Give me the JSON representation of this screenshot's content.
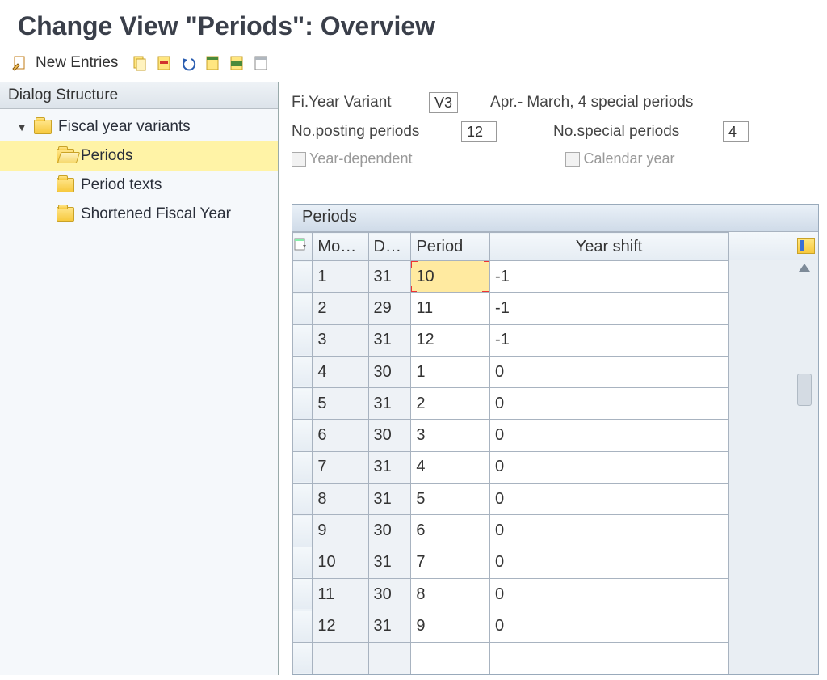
{
  "title": "Change View \"Periods\": Overview",
  "toolbar": {
    "new_entries_label": "New Entries"
  },
  "sidebar": {
    "title": "Dialog Structure",
    "root_label": "Fiscal year variants",
    "items": [
      {
        "label": "Periods",
        "selected": true
      },
      {
        "label": "Period texts",
        "selected": false
      },
      {
        "label": "Shortened Fiscal Year",
        "selected": false
      }
    ]
  },
  "info": {
    "variant_label": "Fi.Year Variant",
    "variant_value": "V3",
    "variant_desc": "Apr.- March, 4 special periods",
    "posting_label": "No.posting periods",
    "posting_value": "12",
    "special_label": "No.special periods",
    "special_value": "4",
    "year_dep_label": "Year-dependent",
    "cal_year_label": "Calendar year"
  },
  "table": {
    "title": "Periods",
    "columns": {
      "mo": "Mo…",
      "day": "D…",
      "period": "Period",
      "ys": "Year shift"
    },
    "rows": [
      {
        "mo": "1",
        "day": "31",
        "period": "10",
        "ys": "-1",
        "focus": true
      },
      {
        "mo": "2",
        "day": "29",
        "period": "11",
        "ys": "-1"
      },
      {
        "mo": "3",
        "day": "31",
        "period": "12",
        "ys": "-1"
      },
      {
        "mo": "4",
        "day": "30",
        "period": "1",
        "ys": "0"
      },
      {
        "mo": "5",
        "day": "31",
        "period": "2",
        "ys": "0"
      },
      {
        "mo": "6",
        "day": "30",
        "period": "3",
        "ys": "0"
      },
      {
        "mo": "7",
        "day": "31",
        "period": "4",
        "ys": "0"
      },
      {
        "mo": "8",
        "day": "31",
        "period": "5",
        "ys": "0"
      },
      {
        "mo": "9",
        "day": "30",
        "period": "6",
        "ys": "0"
      },
      {
        "mo": "10",
        "day": "31",
        "period": "7",
        "ys": "0"
      },
      {
        "mo": "11",
        "day": "30",
        "period": "8",
        "ys": "0"
      },
      {
        "mo": "12",
        "day": "31",
        "period": "9",
        "ys": "0"
      },
      {
        "mo": "",
        "day": "",
        "period": "",
        "ys": ""
      }
    ]
  }
}
